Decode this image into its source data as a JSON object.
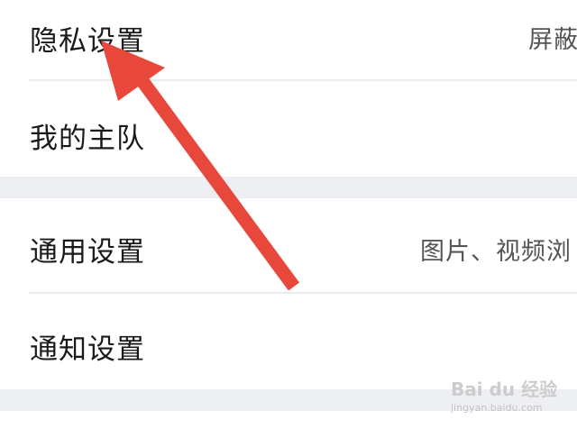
{
  "settings": {
    "group1": [
      {
        "label": "隐私设置",
        "value": "屏蔽"
      },
      {
        "label": "我的主队",
        "value": ""
      }
    ],
    "group2": [
      {
        "label": "通用设置",
        "value": "图片、视频浏"
      },
      {
        "label": "通知设置",
        "value": ""
      }
    ]
  },
  "annotation": {
    "arrow_color": "#e8483b",
    "arrow_icon": "red-pointer-arrow"
  },
  "watermark": {
    "brand": "Bai du 经验",
    "site": "jingyan.baidu.com"
  },
  "colors": {
    "background": "#ffffff",
    "section_gap": "#eeeff2",
    "divider": "#ececef",
    "label_text": "#1a1a1a",
    "value_text": "#555555"
  }
}
